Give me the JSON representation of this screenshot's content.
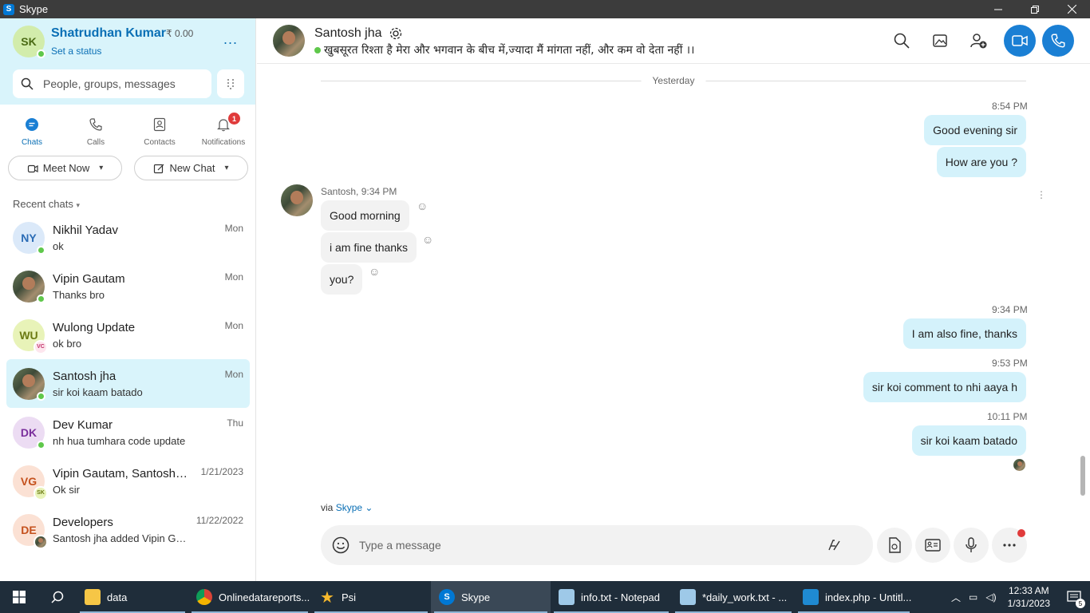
{
  "window": {
    "title": "Skype",
    "app_icon": "S"
  },
  "me": {
    "initials": "SK",
    "name": "Shatrudhan Kumar",
    "credit": "₹ 0.00",
    "status_link": "Set a status",
    "more": "..."
  },
  "search": {
    "placeholder": "People, groups, messages"
  },
  "tabs": [
    {
      "label": "Chats",
      "icon": "chat-icon",
      "active": true
    },
    {
      "label": "Calls",
      "icon": "phone-icon"
    },
    {
      "label": "Contacts",
      "icon": "contacts-icon"
    },
    {
      "label": "Notifications",
      "icon": "bell-icon",
      "badge": "1"
    }
  ],
  "actions": {
    "meet_now": "Meet Now",
    "new_chat": "New Chat"
  },
  "recent_label": "Recent chats",
  "chats": [
    {
      "initials": "NY",
      "name": "Nikhil Yadav",
      "msg": "ok",
      "date": "Mon",
      "color": "#dbe9f9",
      "fg": "#2b6cb5"
    },
    {
      "initials": "",
      "name": "Vipin Gautam",
      "msg": "Thanks bro",
      "date": "Mon"
    },
    {
      "initials": "WU",
      "name": "Wulong Update",
      "msg": "ok bro",
      "date": "Mon",
      "color": "#e8f3b8",
      "fg": "#6b7a12",
      "badge": "VC"
    },
    {
      "initials": "",
      "name": "Santosh  jha",
      "msg": "sir koi kaam batado",
      "date": "Mon"
    },
    {
      "initials": "DK",
      "name": "Dev Kumar",
      "msg": "nh hua tumhara code update",
      "date": "Thu",
      "color": "#ecdcf3",
      "fg": "#7a2f9c"
    },
    {
      "initials": "VG",
      "name": "Vipin Gautam, Santosh…",
      "msg": "Ok sir",
      "date": "1/21/2023",
      "color": "#fbe1d4",
      "fg": "#c4511d",
      "badge": "SK"
    },
    {
      "initials": "DE",
      "name": "Developers",
      "msg": "Santosh  jha added Vipin G…",
      "date": "11/22/2022",
      "color": "#fbe1d4",
      "fg": "#c4511d"
    }
  ],
  "conversation": {
    "name": "Santosh  jha",
    "mood": "खुबसूरत रिश्ता है मेरा और भगवान के बीच में,ज्यादा मैं मांगता नहीं, और कम वो देता नहीं ।।",
    "day": "Yesterday",
    "times": [
      "8:54 PM",
      "9:34 PM",
      "9:53 PM",
      "10:11 PM"
    ],
    "outgoing_1": [
      "Good evening sir",
      "How are you ?"
    ],
    "sender_meta": "Santosh, 9:34 PM",
    "incoming": [
      "Good morning",
      "i am fine thanks",
      "you?"
    ],
    "outgoing_2": "I am also fine, thanks",
    "outgoing_3": "sir koi comment to nhi aaya h",
    "outgoing_4": "sir koi kaam batado",
    "via_prefix": "via",
    "via_link": "Skype"
  },
  "composer": {
    "placeholder": "Type a message"
  },
  "taskbar": {
    "items": [
      {
        "label": "data",
        "icon": "folder-icon"
      },
      {
        "label": "Onlinedatareports...",
        "icon": "chrome-icon"
      },
      {
        "label": "Psi",
        "icon": "star-icon"
      },
      {
        "label": "Skype",
        "icon": "skype-icon"
      },
      {
        "label": "info.txt - Notepad",
        "icon": "notepad-icon"
      },
      {
        "label": "*daily_work.txt - ...",
        "icon": "notepad-icon"
      },
      {
        "label": "index.php - Untitl...",
        "icon": "vscode-icon"
      }
    ],
    "time": "12:33 AM",
    "date": "1/31/2023",
    "notification_count": "5"
  }
}
